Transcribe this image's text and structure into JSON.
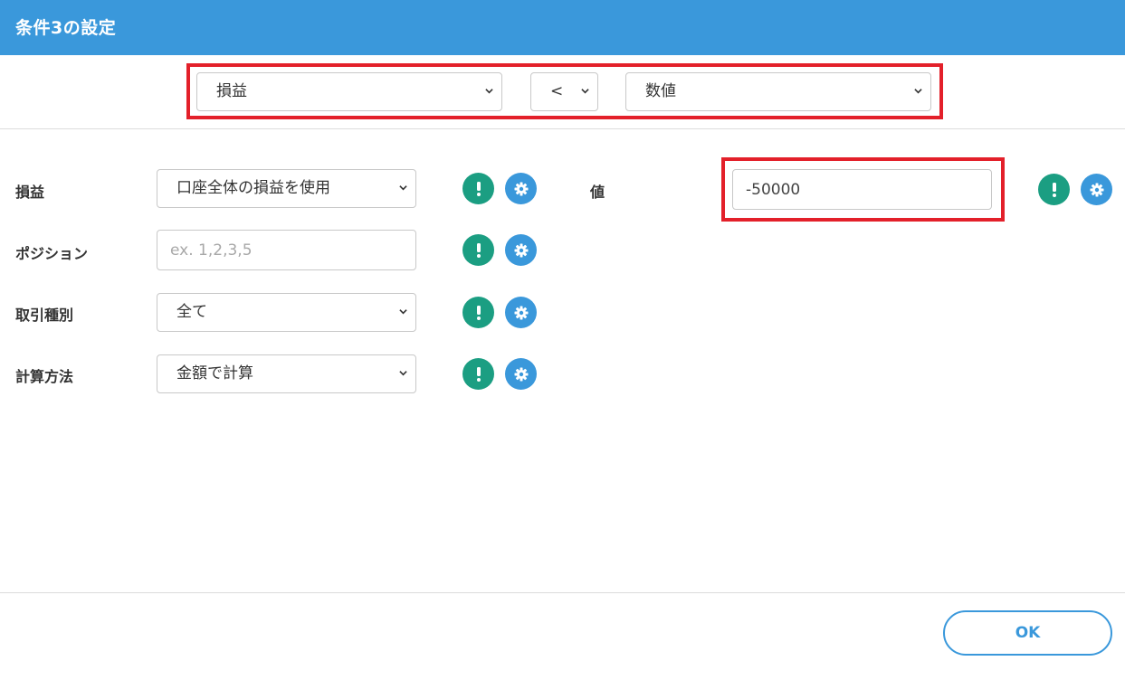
{
  "dialog": {
    "title": "条件3の設定"
  },
  "condition": {
    "left_select": "損益",
    "operator_select": "<",
    "right_select": "数値"
  },
  "fields": [
    {
      "label": "損益",
      "type": "select",
      "value": "口座全体の損益を使用"
    },
    {
      "label": "ポジション",
      "type": "input",
      "value": "",
      "placeholder": "ex. 1,2,3,5"
    },
    {
      "label": "取引種別",
      "type": "select",
      "value": "全て"
    },
    {
      "label": "計算方法",
      "type": "select",
      "value": "金額で計算"
    }
  ],
  "value_field": {
    "label": "値",
    "value": "-50000"
  },
  "footer": {
    "ok_label": "OK"
  },
  "colors": {
    "header": "#3a98db",
    "info_button": "#1b9e82",
    "settings_button": "#3a98db",
    "highlight": "#e3202a"
  },
  "icons": {
    "info": "exclamation-icon",
    "settings": "gear-icon",
    "dropdown": "chevron-down-icon"
  }
}
